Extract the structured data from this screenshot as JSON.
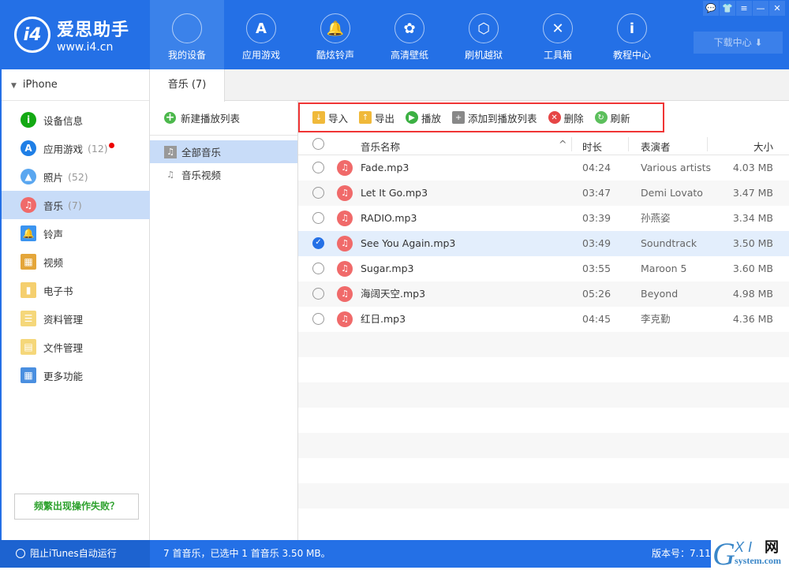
{
  "app": {
    "logo_name": "爱思助手",
    "logo_url": "www.i4.cn",
    "logo_mark": "i4"
  },
  "nav": [
    {
      "label": "我的设备",
      "icon": "apple-icon",
      "glyph": ""
    },
    {
      "label": "应用游戏",
      "icon": "app-store-icon",
      "glyph": "A"
    },
    {
      "label": "酷炫铃声",
      "icon": "bell-icon",
      "glyph": "🔔"
    },
    {
      "label": "高清壁纸",
      "icon": "flower-icon",
      "glyph": "✿"
    },
    {
      "label": "刷机越狱",
      "icon": "box-icon",
      "glyph": "⬡"
    },
    {
      "label": "工具箱",
      "icon": "tools-icon",
      "glyph": "✕"
    },
    {
      "label": "教程中心",
      "icon": "info-icon",
      "glyph": "i"
    }
  ],
  "window": {
    "buttons": [
      "💬",
      "👕",
      "≡",
      "—",
      "✕"
    ],
    "download": "下载中心 ⬇"
  },
  "sidebar": {
    "device": "iPhone",
    "items": [
      {
        "label": "设备信息",
        "icon": "info-icon",
        "color": "#13a913",
        "glyph": "i",
        "count": ""
      },
      {
        "label": "应用游戏",
        "icon": "app-store-icon",
        "color": "#1f7fe6",
        "glyph": "A",
        "count": "(12)",
        "badge": true
      },
      {
        "label": "照片",
        "icon": "photo-icon",
        "color": "#5aa7f0",
        "glyph": "▲",
        "count": "(52)"
      },
      {
        "label": "音乐",
        "icon": "music-icon",
        "color": "#f06a6a",
        "glyph": "♫",
        "count": "(7)",
        "active": true
      },
      {
        "label": "铃声",
        "icon": "bell-icon",
        "color": "#3b94f0",
        "glyph": "🔔",
        "count": ""
      },
      {
        "label": "视频",
        "icon": "video-icon",
        "color": "#e4a63a",
        "glyph": "▦",
        "count": ""
      },
      {
        "label": "电子书",
        "icon": "book-icon",
        "color": "#f5cf6e",
        "glyph": "▮",
        "count": ""
      },
      {
        "label": "资料管理",
        "icon": "contacts-icon",
        "color": "#f5d77a",
        "glyph": "☰",
        "count": ""
      },
      {
        "label": "文件管理",
        "icon": "file-icon",
        "color": "#f5d77a",
        "glyph": "▤",
        "count": ""
      },
      {
        "label": "更多功能",
        "icon": "grid-icon",
        "color": "#4a8fe0",
        "glyph": "▦",
        "count": ""
      }
    ],
    "help_button": "频繁出现操作失败？"
  },
  "tab": "音乐 (7)",
  "playlists": {
    "new_label": "新建播放列表",
    "items": [
      {
        "label": "全部音乐",
        "active": true
      },
      {
        "label": "音乐视频"
      }
    ]
  },
  "toolbar": [
    {
      "label": "导入",
      "icon": "import-icon",
      "color": "#f0b93a",
      "glyph": "↓"
    },
    {
      "label": "导出",
      "icon": "export-icon",
      "color": "#f0b93a",
      "glyph": "↑"
    },
    {
      "label": "播放",
      "icon": "play-icon",
      "color": "#3cb043",
      "glyph": "▶"
    },
    {
      "label": "添加到播放列表",
      "icon": "add-to-playlist-icon",
      "color": "#888",
      "glyph": "+"
    },
    {
      "label": "删除",
      "icon": "delete-icon",
      "color": "#e64545",
      "glyph": "✕"
    },
    {
      "label": "刷新",
      "icon": "refresh-icon",
      "color": "#5cbf5c",
      "glyph": "↻"
    }
  ],
  "table": {
    "columns": [
      "音乐名称",
      "时长",
      "表演者",
      "大小"
    ],
    "sort_indicator": "^",
    "rows": [
      {
        "name": "Fade.mp3",
        "duration": "04:24",
        "artist": "Various artists",
        "size": "4.03 MB"
      },
      {
        "name": "Let It Go.mp3",
        "duration": "03:47",
        "artist": "Demi Lovato",
        "size": "3.47 MB"
      },
      {
        "name": "RADIO.mp3",
        "duration": "03:39",
        "artist": "孙燕姿",
        "size": "3.34 MB"
      },
      {
        "name": "See You Again.mp3",
        "duration": "03:49",
        "artist": "Soundtrack",
        "size": "3.50 MB",
        "selected": true
      },
      {
        "name": "Sugar.mp3",
        "duration": "03:55",
        "artist": "Maroon 5",
        "size": "3.60 MB"
      },
      {
        "name": "海阔天空.mp3",
        "duration": "05:26",
        "artist": "Beyond",
        "size": "4.98 MB"
      },
      {
        "name": "红日.mp3",
        "duration": "04:45",
        "artist": "李克勤",
        "size": "4.36 MB"
      }
    ]
  },
  "status": {
    "itunes": "阻止iTunes自动运行",
    "summary": "7 首音乐，已选中 1 首音乐 3.50 MB。",
    "version": "版本号：7.11"
  },
  "watermark": {
    "text": "GXI网",
    "sub": "system.com"
  }
}
